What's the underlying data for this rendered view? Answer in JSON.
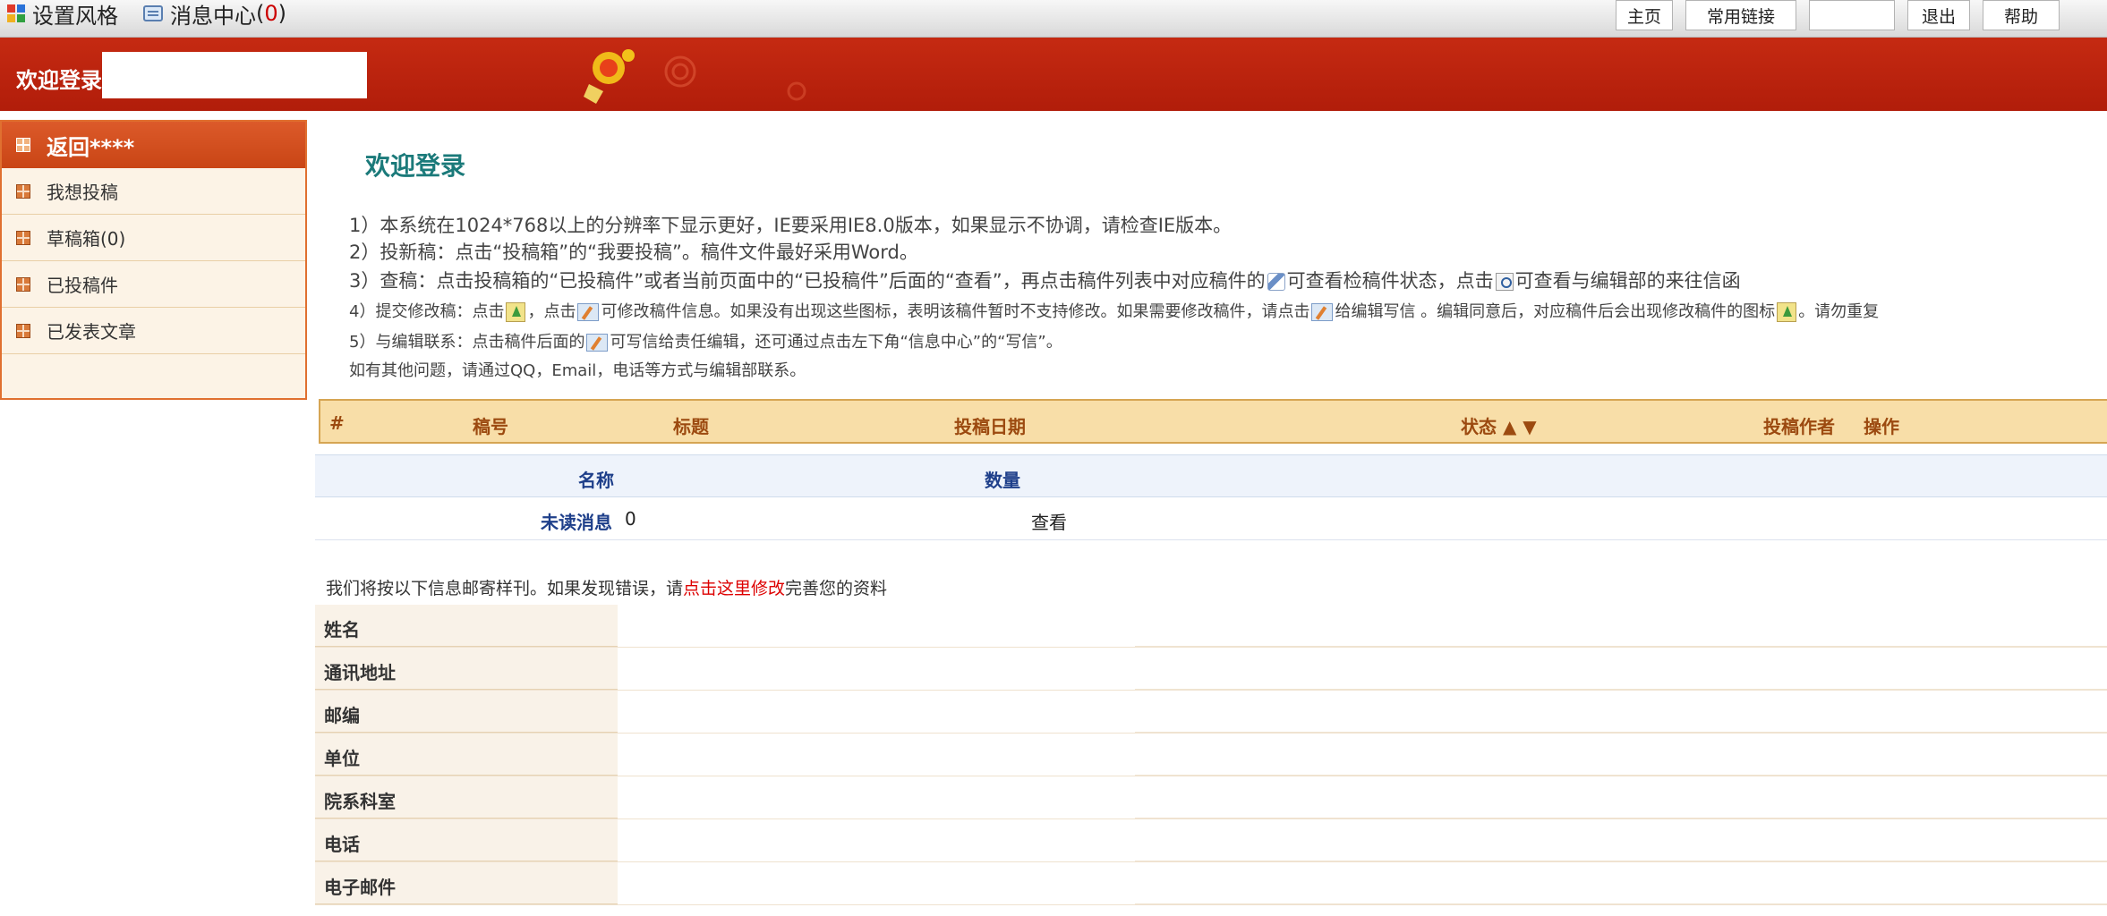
{
  "topbar": {
    "style_label": "设置风格",
    "msg_center_label": "消息中心",
    "msg_center_count_open": "(",
    "msg_center_count": "0",
    "msg_center_count_close": ")",
    "buttons": {
      "home": "主页",
      "links": "常用链接",
      "blank": "",
      "logout": "退出",
      "help": "帮助"
    }
  },
  "banner": {
    "welcome": "欢迎登录",
    "username": ""
  },
  "sidebar": {
    "back": "返回****",
    "items": [
      {
        "label": "我想投稿"
      },
      {
        "label": "草稿箱(0)"
      },
      {
        "label": "已投稿件"
      },
      {
        "label": "已发表文章"
      }
    ]
  },
  "main": {
    "title": "欢迎登录",
    "tip1": "1）本系统在1024*768以上的分辨率下显示更好，IE要采用IE8.0版本，如果显示不协调，请检查IE版本。",
    "tip2": "2）投新稿：点击“投稿箱”的“我要投稿”。稿件文件最好采用Word。",
    "tip3a": "3）查稿：点击投稿箱的“已投稿件”或者当前页面中的“已投稿件”后面的“查看”，再点击稿件列表中对应稿件的",
    "tip3b": "可查看检稿件状态，点击",
    "tip3c": "可查看与编辑部的来往信函",
    "tip4a": "4）提交修改稿：点击",
    "tip4b": "，点击",
    "tip4c": "可修改稿件信息。如果没有出现这些图标，表明该稿件暂时不支持修改。如果需要修改稿件，请点击",
    "tip4d": "给编辑写信 。编辑同意后，对应稿件后会出现修改稿件的图标",
    "tip4e": "。请勿重复",
    "tip5a": "5）与编辑联系：点击稿件后面的",
    "tip5b": "可写信给责任编辑，还可通过点击左下角“信息中心”的“写信”。",
    "tip6": "如有其他问题，请通过QQ，Email，电话等方式与编辑部联系。"
  },
  "manuscripts": {
    "headers": {
      "num": "#",
      "code": "稿号",
      "title": "标题",
      "date": "投稿日期",
      "status": "状态 ▲ ▼",
      "author": "投稿作者",
      "action": "操作"
    }
  },
  "messages": {
    "headers": {
      "name": "名称",
      "count": "数量"
    },
    "row": {
      "name": "未读消息",
      "count": "0",
      "action": "查看"
    }
  },
  "profile": {
    "note_prefix": "我们将按以下信息邮寄样刊。如果发现错误，请",
    "note_link": "点击这里修改",
    "note_suffix": "完善您的资料",
    "fields": [
      "姓名",
      "通讯地址",
      "邮编",
      "单位",
      "院系科室",
      "电话",
      "电子邮件"
    ]
  },
  "colors": {
    "banner_red": "#b9230d",
    "sidebar_orange": "#d6561f",
    "title_teal": "#1b7a7a",
    "link_red": "#dd0000",
    "table_header": "#f8dea8"
  }
}
